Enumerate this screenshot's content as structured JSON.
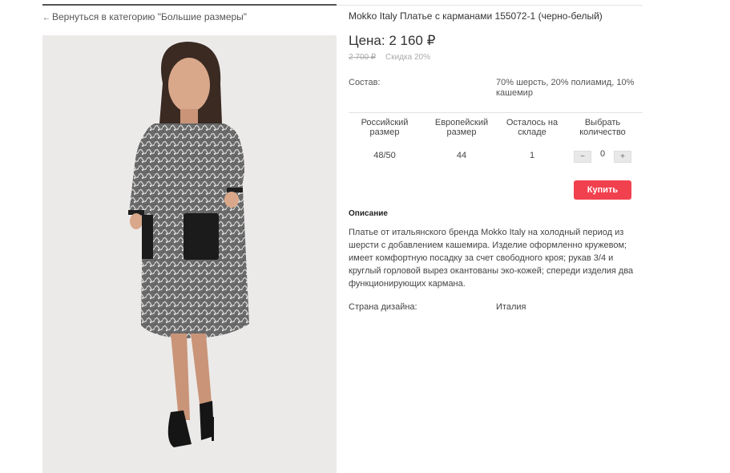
{
  "navigation": {
    "back_arrow": "←",
    "back_label": "Вернуться в категорию \"Большие размеры\""
  },
  "product": {
    "title": "Mokko Italy Платье с карманами 155072-1 (черно-белый)",
    "price": "Цена: 2 160 ₽",
    "old_price": "2 700 ₽",
    "discount": "Скидка 20%",
    "composition_label": "Состав:",
    "composition_value": "70% шерсть, 20% полиамид, 10% кашемир",
    "image_icon": "dress-photo"
  },
  "size_table": {
    "headers": [
      "Российский размер",
      "Европейский размер",
      "Осталось на складе",
      "Выбрать количество"
    ],
    "row": {
      "ru_size": "48/50",
      "eu_size": "44",
      "in_stock": "1",
      "quantity": "0"
    },
    "minus": "−",
    "plus": "+"
  },
  "buy_label": "Купить",
  "description": {
    "heading": "Описание",
    "text": "Платье от итальянского бренда Mokko Italy на холодный период из шерсти с добавлением кашемира. Изделие оформленно кружевом; имеет комфортную посадку за счет свободного кроя; рукав 3/4 и круглый горловой вырез окантованы эко-кожей; спереди изделия два функционирующих кармана."
  },
  "country": {
    "label": "Страна дизайна:",
    "value": "Италия"
  },
  "colors": {
    "accent": "#f2414e",
    "text": "#333333",
    "muted": "#aaaaaa"
  }
}
